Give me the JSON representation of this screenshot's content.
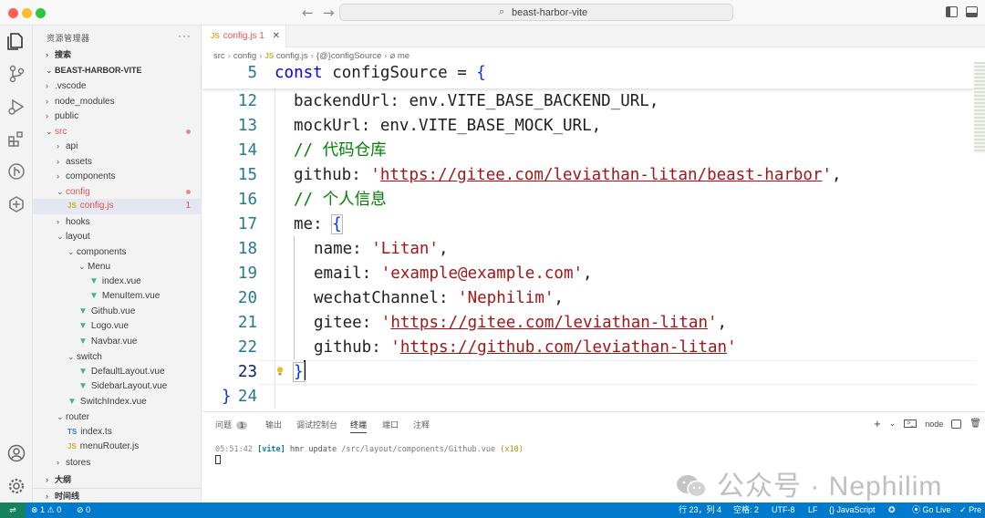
{
  "window": {
    "search_text": "beast-harbor-vite"
  },
  "sidebar": {
    "title": "资源管理器",
    "search_section": "搜索",
    "project_name": "BEAST-HARBOR-VITE",
    "outline_section": "大纲",
    "timeline_section": "时间线",
    "tree": [
      {
        "label": ".vscode",
        "kind": "folder-closed"
      },
      {
        "label": "node_modules",
        "kind": "folder-closed"
      },
      {
        "label": "public",
        "kind": "folder-closed"
      },
      {
        "label": "src",
        "kind": "folder-open",
        "modified": true
      },
      {
        "label": "api",
        "kind": "folder-closed"
      },
      {
        "label": "assets",
        "kind": "folder-closed"
      },
      {
        "label": "components",
        "kind": "folder-closed"
      },
      {
        "label": "config",
        "kind": "folder-open",
        "modified": true
      },
      {
        "label": "config.js",
        "kind": "js",
        "problems": "1"
      },
      {
        "label": "hooks",
        "kind": "folder-closed"
      },
      {
        "label": "layout",
        "kind": "folder-open"
      },
      {
        "label": "components",
        "kind": "folder-open"
      },
      {
        "label": "Menu",
        "kind": "folder-open"
      },
      {
        "label": "index.vue",
        "kind": "vue"
      },
      {
        "label": "MenuItem.vue",
        "kind": "vue"
      },
      {
        "label": "Github.vue",
        "kind": "vue"
      },
      {
        "label": "Logo.vue",
        "kind": "vue"
      },
      {
        "label": "Navbar.vue",
        "kind": "vue"
      },
      {
        "label": "switch",
        "kind": "folder-open"
      },
      {
        "label": "DefaultLayout.vue",
        "kind": "vue"
      },
      {
        "label": "SidebarLayout.vue",
        "kind": "vue"
      },
      {
        "label": "SwitchIndex.vue",
        "kind": "vue"
      },
      {
        "label": "router",
        "kind": "folder-open"
      },
      {
        "label": "index.ts",
        "kind": "ts"
      },
      {
        "label": "menuRouter.js",
        "kind": "js"
      },
      {
        "label": "stores",
        "kind": "folder-closed"
      }
    ]
  },
  "tab": {
    "label": "config.js",
    "problems": "1"
  },
  "breadcrumb": {
    "p1": "src",
    "p2": "config",
    "p3": "config.js",
    "p4": "configSource",
    "p5": "me"
  },
  "editor": {
    "sticky": {
      "ln": "5",
      "kw": "const",
      "name": " configSource = ",
      "brace": "{"
    },
    "lines": [
      {
        "ln": "12",
        "key": "backendUrl: ",
        "val": "env.VITE_BASE_BACKEND_URL,"
      },
      {
        "ln": "13",
        "key": "mockUrl: ",
        "val": "env.VITE_BASE_MOCK_URL,"
      },
      {
        "ln": "14",
        "comment": "// 代码仓库"
      },
      {
        "ln": "15",
        "key": "github: ",
        "q1": "'",
        "url": "https://gitee.com/leviathan-litan/beast-harbor",
        "q2": "'",
        "tail": ","
      },
      {
        "ln": "16",
        "comment": "// 个人信息"
      },
      {
        "ln": "17",
        "key": "me: ",
        "brace": "{"
      },
      {
        "ln": "18",
        "key": "name: ",
        "str": "'Litan'",
        "tail": ","
      },
      {
        "ln": "19",
        "key": "email: ",
        "str": "'example@example.com'",
        "tail": ","
      },
      {
        "ln": "20",
        "key": "wechatChannel: ",
        "str": "'Nephilim'",
        "tail": ","
      },
      {
        "ln": "21",
        "key": "gitee: ",
        "q1": "'",
        "url": "https://gitee.com/leviathan-litan",
        "q2": "'",
        "tail": ","
      },
      {
        "ln": "22",
        "key": "github: ",
        "q1": "'",
        "url": "https://github.com/leviathan-litan",
        "q2": "'"
      },
      {
        "ln": "23",
        "brace": "}"
      },
      {
        "ln": "24",
        "brace": "}"
      }
    ]
  },
  "panel": {
    "tabs": [
      "问题",
      "输出",
      "调试控制台",
      "终端",
      "端口",
      "注释"
    ],
    "problems_count": "1",
    "active_tab": "终端",
    "shell": "node",
    "terminal": {
      "time": "05:51:42",
      "tag": "[vite]",
      "msg": " hmr update ",
      "path": "/src/layout/components/Github.vue",
      "count": "(x10)"
    }
  },
  "watermark": "公众号 · Nephilim",
  "statusbar": {
    "errors": "1",
    "warnings": "0",
    "ports": "0",
    "position": "行 23，列 4",
    "spaces": "空格: 2",
    "encoding": "UTF-8",
    "eol": "LF",
    "language": "JavaScript",
    "golive": "Go Live",
    "prettier": "Pre"
  }
}
